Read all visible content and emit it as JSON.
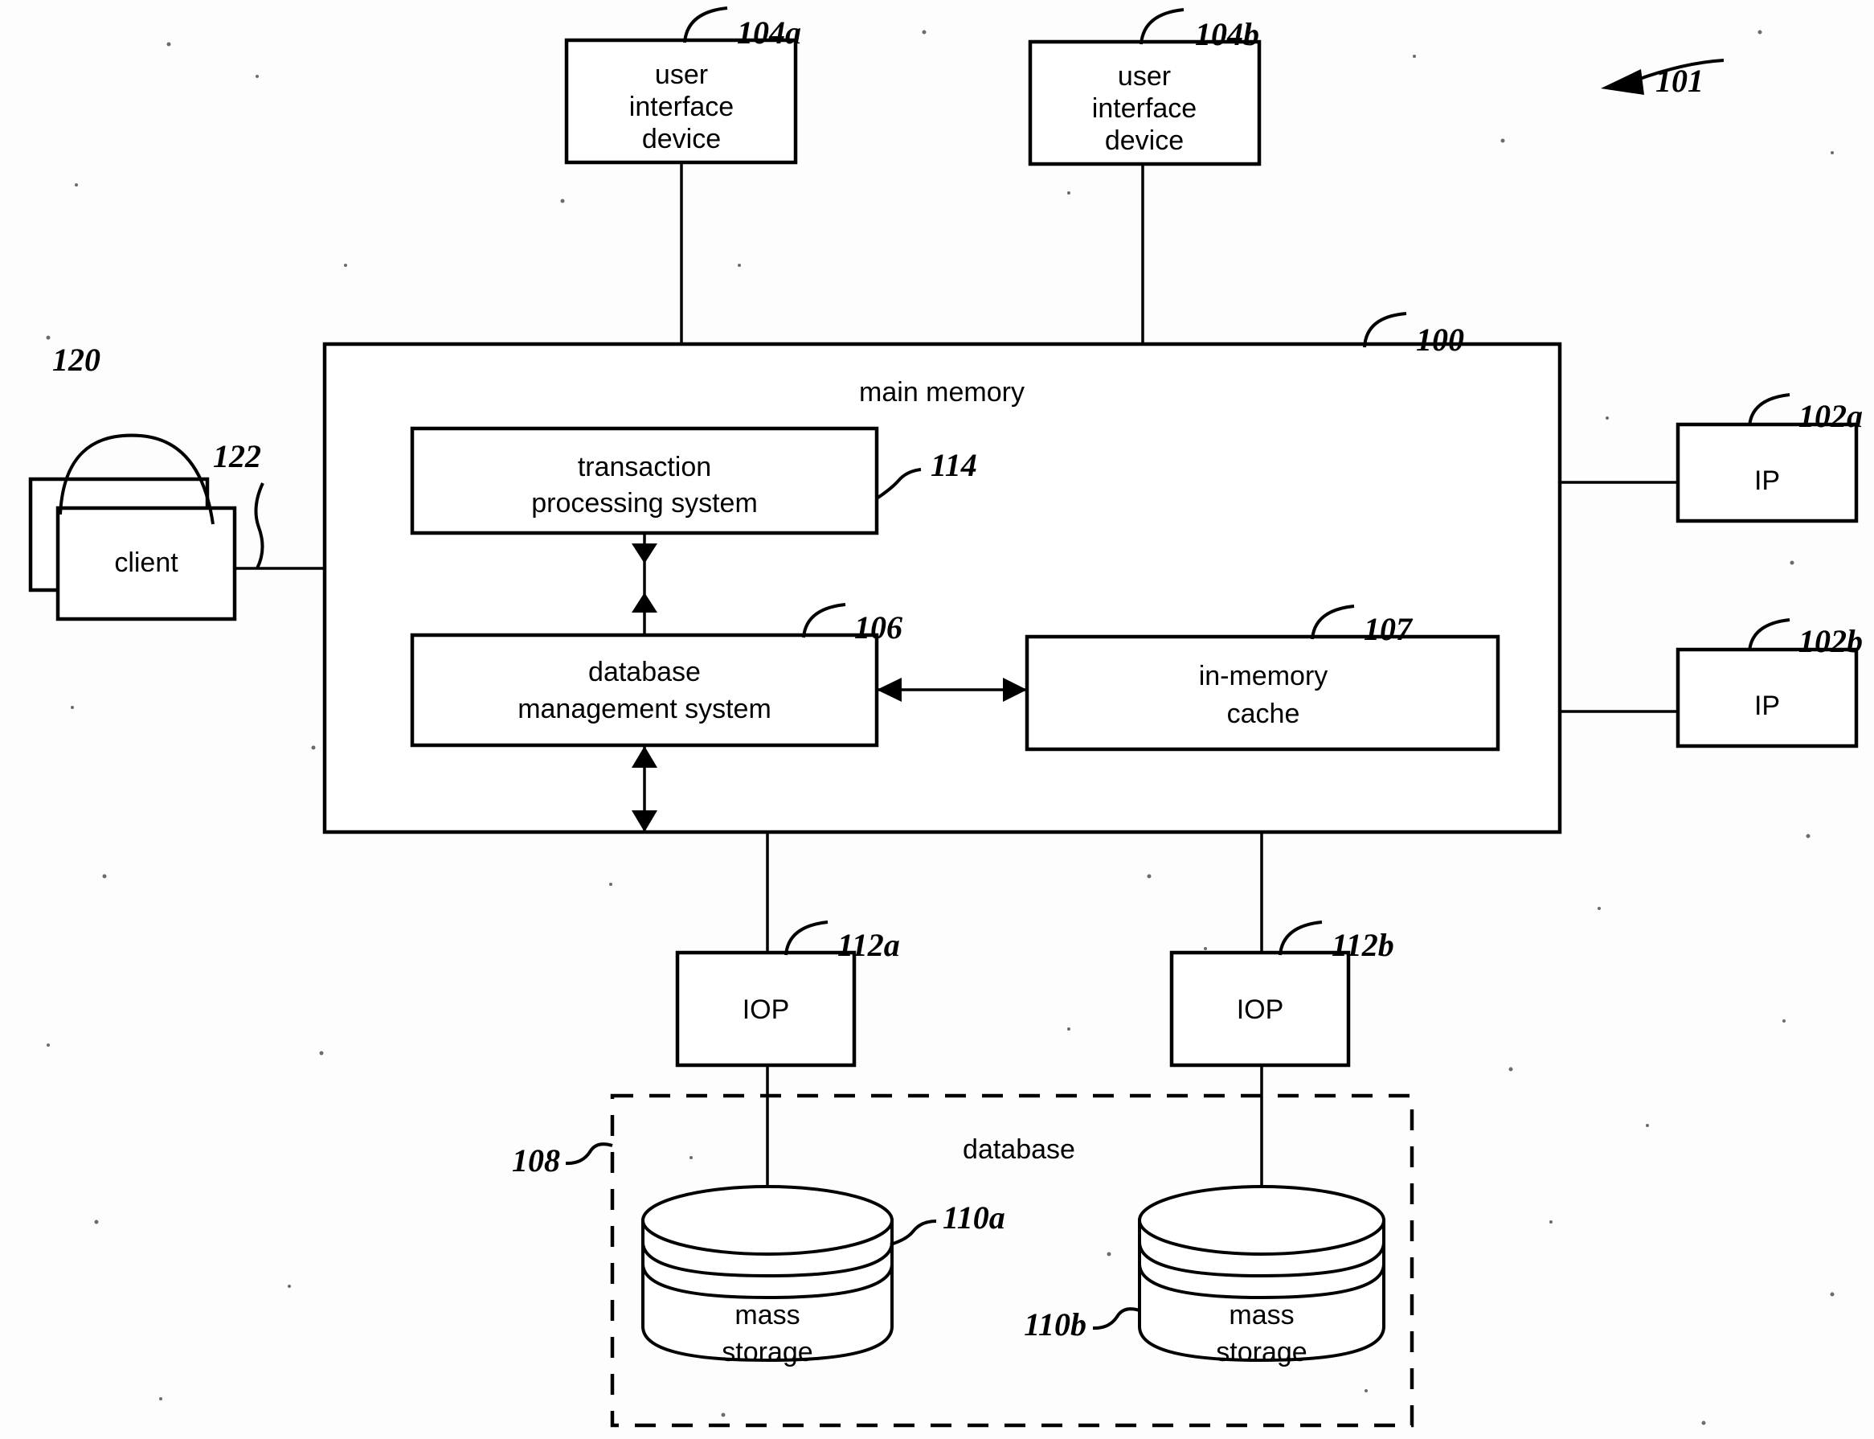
{
  "figure": {
    "title": "Computer system architecture block diagram",
    "figure_ref": "101"
  },
  "blocks": {
    "user_interface_device_a": {
      "label_line1": "user",
      "label_line2": "interface",
      "label_line3": "device",
      "ref": "104a"
    },
    "user_interface_device_b": {
      "label_line1": "user",
      "label_line2": "interface",
      "label_line3": "device",
      "ref": "104b"
    },
    "main_memory": {
      "label": "main memory",
      "ref": "100"
    },
    "transaction_processing_system": {
      "label_line1": "transaction",
      "label_line2": "processing system",
      "ref": "114"
    },
    "database_management_system": {
      "label_line1": "database",
      "label_line2": "management system",
      "ref": "106"
    },
    "in_memory_cache": {
      "label_line1": "in-memory",
      "label_line2": "cache",
      "ref": "107"
    },
    "client": {
      "label": "client",
      "ref_stack": "120",
      "ref_link": "122"
    },
    "ip_a": {
      "label": "IP",
      "ref": "102a"
    },
    "ip_b": {
      "label": "IP",
      "ref": "102b"
    },
    "iop_a": {
      "label": "IOP",
      "ref": "112a"
    },
    "iop_b": {
      "label": "IOP",
      "ref": "112b"
    },
    "database_region": {
      "label": "database",
      "ref": "108"
    },
    "mass_storage_a": {
      "label_line1": "mass",
      "label_line2": "storage",
      "ref": "110a"
    },
    "mass_storage_b": {
      "label_line1": "mass",
      "label_line2": "storage",
      "ref": "110b"
    }
  },
  "colors": {
    "stroke": "#000000",
    "background": "#ffffff"
  }
}
